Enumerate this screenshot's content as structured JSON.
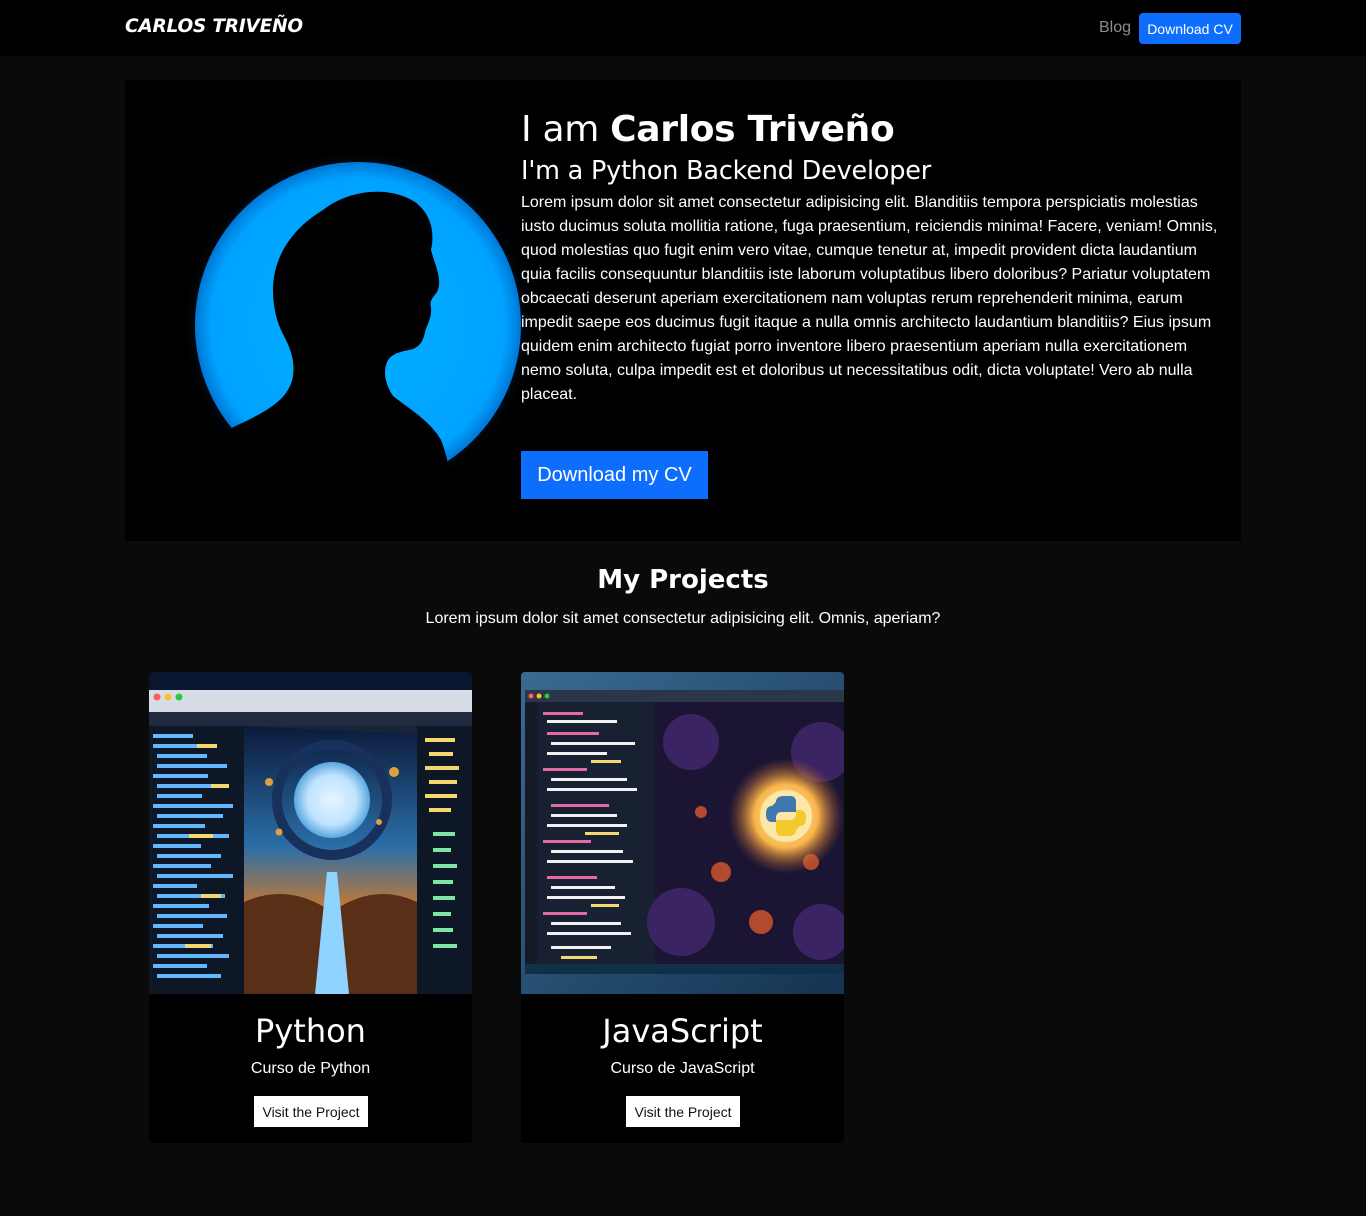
{
  "navbar": {
    "brand": "CARLOS TRIVEÑO",
    "blog_label": "Blog",
    "cv_button": "Download CV"
  },
  "hero": {
    "title_prefix": "I am ",
    "title_name": "Carlos Triveño",
    "subtitle": "I'm a Python Backend Developer",
    "description": "Lorem ipsum dolor sit amet consectetur adipisicing elit. Blanditiis tempora perspiciatis molestias iusto ducimus soluta mollitia ratione, fuga praesentium, reiciendis minima! Facere, veniam! Omnis, quod molestias quo fugit enim vero vitae, cumque tenetur at, impedit provident dicta laudantium quia facilis consequuntur blanditiis iste laborum voluptatibus libero doloribus? Pariatur voluptatem obcaecati deserunt aperiam exercitationem nam voluptas rerum reprehenderit minima, earum impedit saepe eos ducimus fugit itaque a nulla omnis architecto laudantium blanditiis? Eius ipsum quidem enim architecto fugiat porro inventore libero praesentium aperiam nulla exercitationem nemo soluta, culpa impedit est et doloribus ut necessitatibus odit, dicta voluptate! Vero ab nulla placeat.",
    "button": "Download my CV",
    "accent_color": "#0d6efd",
    "halo_color": "#00a2ff"
  },
  "projects": {
    "title": "My Projects",
    "subtitle": "Lorem ipsum dolor sit amet consectetur adipisicing elit. Omnis, aperiam?",
    "items": [
      {
        "title": "Python",
        "text": "Curso de Python",
        "button": "Visit the Project"
      },
      {
        "title": "JavaScript",
        "text": "Curso de JavaScript",
        "button": "Visit the Project"
      }
    ]
  }
}
